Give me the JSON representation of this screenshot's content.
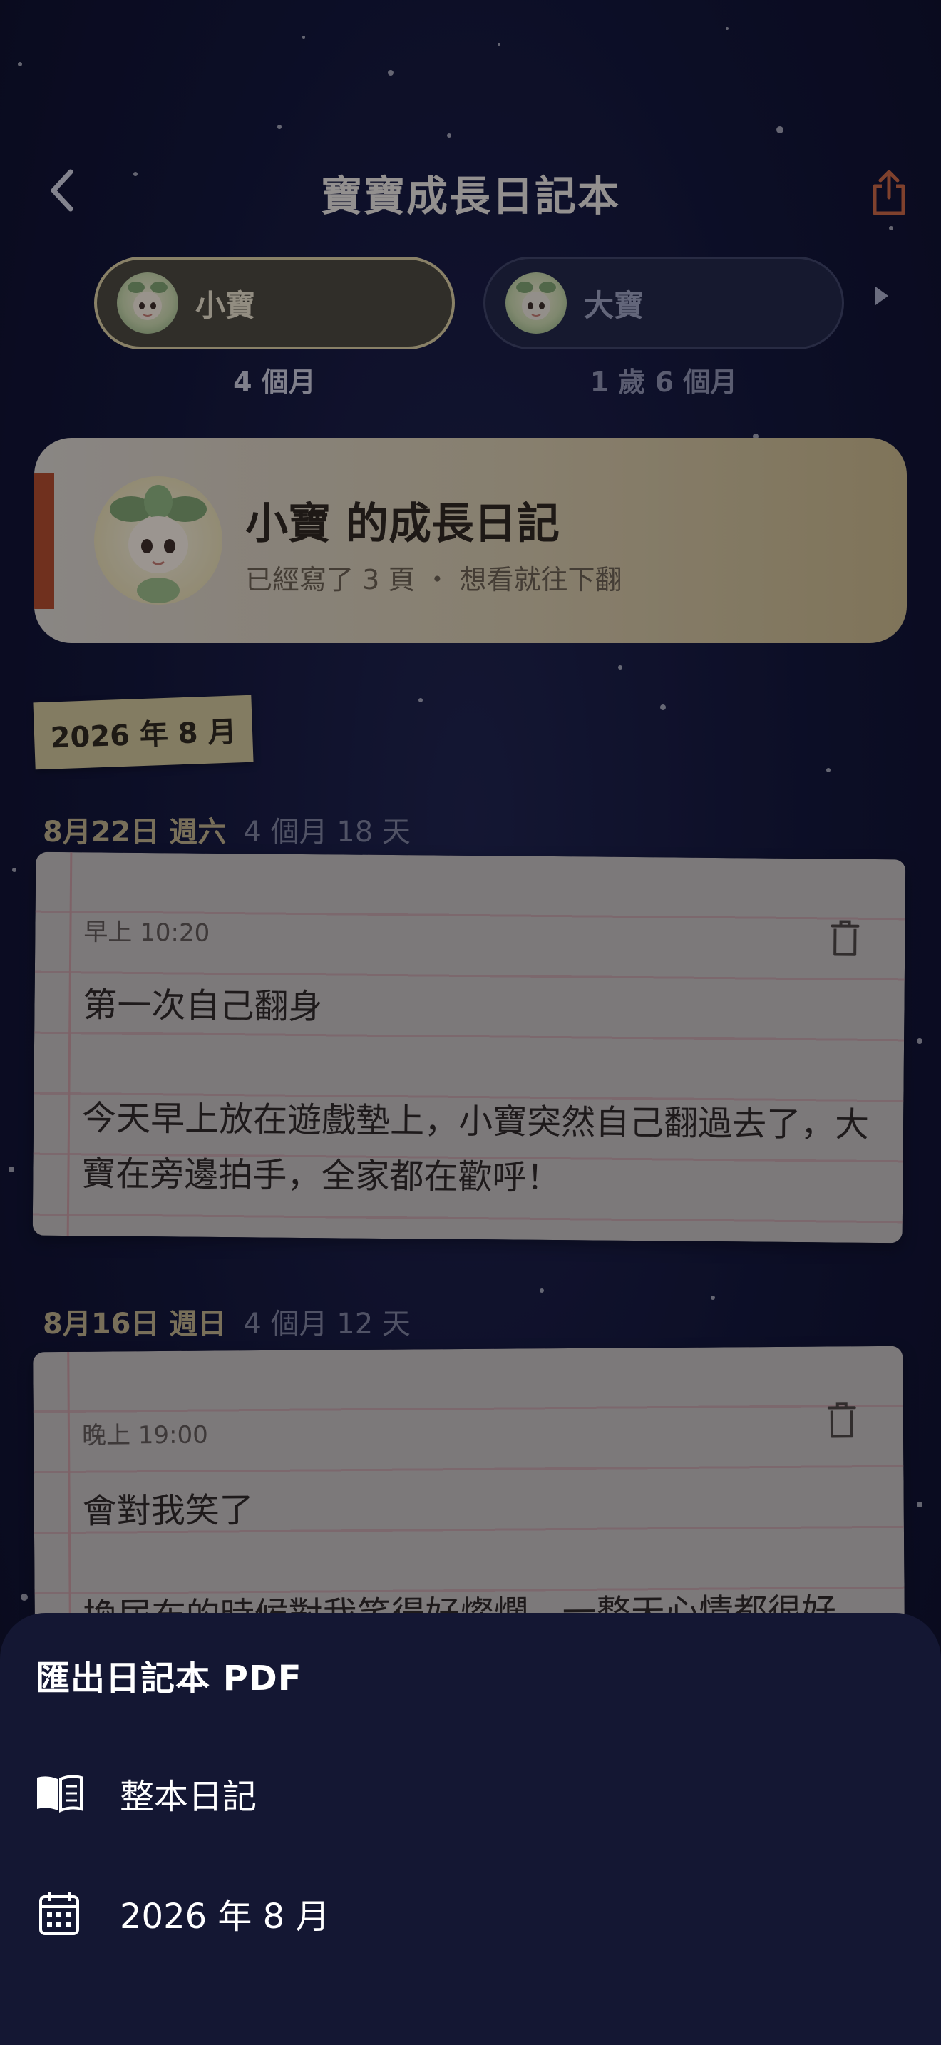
{
  "header": {
    "title": "寶寶成長日記本"
  },
  "children": [
    {
      "name": "小寶",
      "age": "4 個月",
      "selected": true
    },
    {
      "name": "大寶",
      "age": "1 歲 6 個月",
      "selected": false
    }
  ],
  "summary": {
    "title": "小寶 的成長日記",
    "subtitle": "已經寫了 3 頁 ・ 想看就往下翻"
  },
  "month_label": "2026 年 8 月",
  "entries": [
    {
      "date": "8月22日 週六",
      "age": "4 個月 18 天",
      "time": "早上 10:20",
      "headline": "第一次自己翻身",
      "body": "今天早上放在遊戲墊上，小寶突然自己翻過去了，大寶在旁邊拍手，全家都在歡呼！"
    },
    {
      "date": "8月16日 週日",
      "age": "4 個月 12 天",
      "time": "晚上 19:00",
      "headline": "會對我笑了",
      "body": "換尿布的時候對我笑得好燦爛，一整天心情都很好。"
    }
  ],
  "export_sheet": {
    "title": "匯出日記本 PDF",
    "options": [
      {
        "icon": "book-icon",
        "label": "整本日記"
      },
      {
        "icon": "calendar-icon",
        "label": "2026 年 8 月"
      }
    ]
  },
  "colors": {
    "background": "#0f1230",
    "accent_gold": "#d8cc9a",
    "share_orange": "#c8643c",
    "ribbon": "#b04a25",
    "sheet": "#141733"
  }
}
